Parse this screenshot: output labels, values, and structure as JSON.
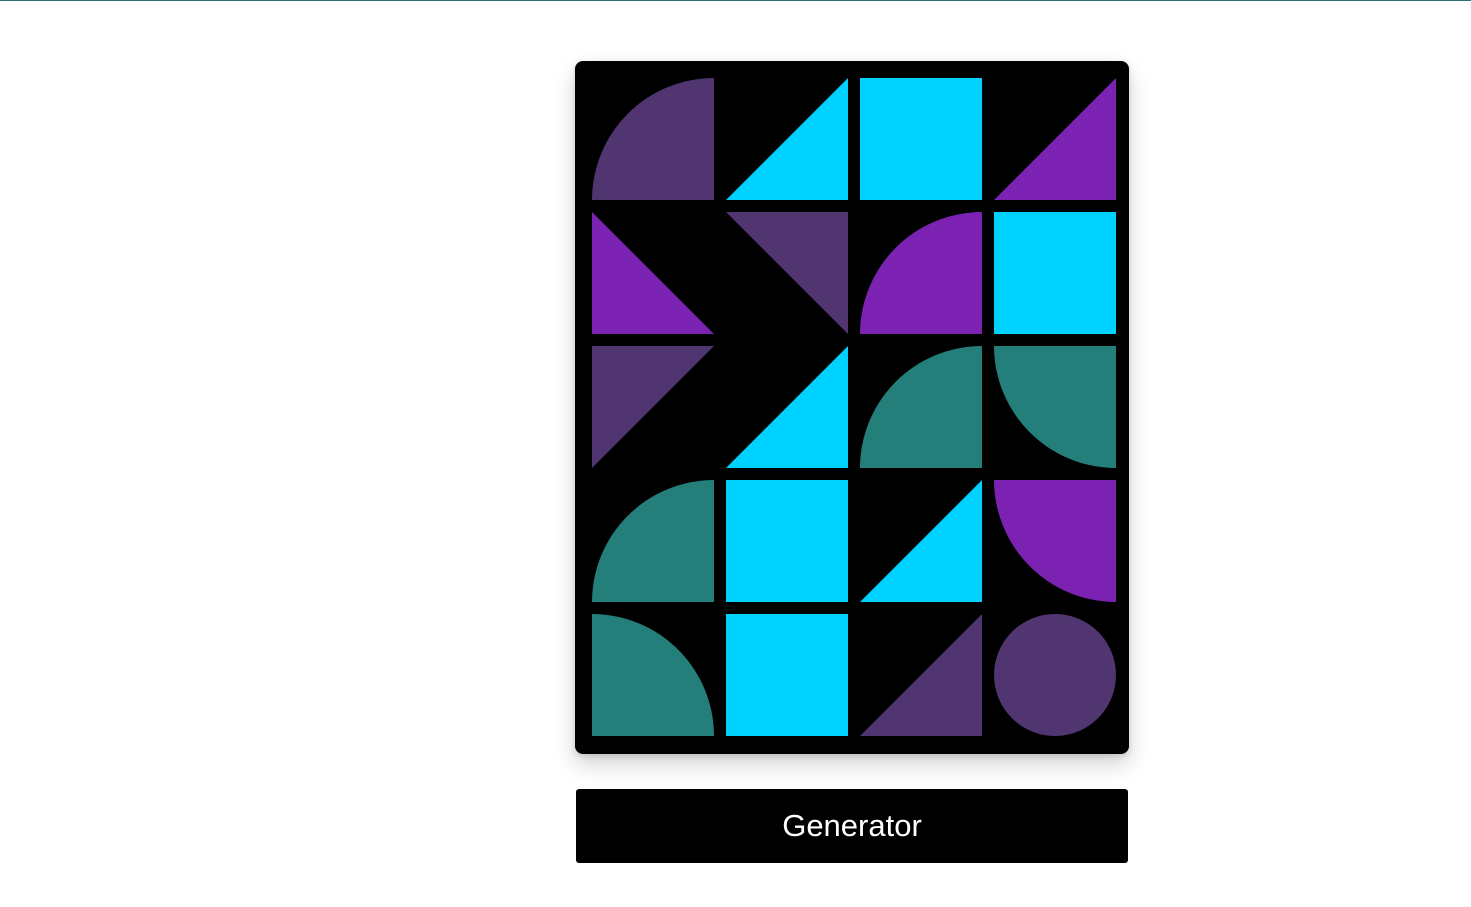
{
  "palette": {
    "black": "#000000",
    "cyan": "#00d2ff",
    "purple": "#7b22b3",
    "plum": "#513570",
    "teal": "#247f7b"
  },
  "grid": {
    "columns": 4,
    "rows": 5,
    "tiles": [
      {
        "shape": "quarter-circle-bottom-right",
        "color": "plum"
      },
      {
        "shape": "triangle-bottom-right",
        "color": "cyan"
      },
      {
        "shape": "square",
        "color": "cyan"
      },
      {
        "shape": "triangle-bottom-right",
        "color": "purple"
      },
      {
        "shape": "triangle-bottom-left",
        "color": "purple"
      },
      {
        "shape": "triangle-top-right",
        "color": "plum"
      },
      {
        "shape": "quarter-circle-bottom-right",
        "color": "purple"
      },
      {
        "shape": "square",
        "color": "cyan"
      },
      {
        "shape": "triangle-top-left",
        "color": "plum"
      },
      {
        "shape": "triangle-bottom-right",
        "color": "cyan"
      },
      {
        "shape": "quarter-circle-bottom-right",
        "color": "teal"
      },
      {
        "shape": "quarter-circle-top-right",
        "color": "teal"
      },
      {
        "shape": "quarter-circle-bottom-right",
        "color": "teal"
      },
      {
        "shape": "square",
        "color": "cyan"
      },
      {
        "shape": "triangle-bottom-right",
        "color": "cyan"
      },
      {
        "shape": "quarter-circle-top-right",
        "color": "purple"
      },
      {
        "shape": "quarter-circle-bottom-left",
        "color": "teal"
      },
      {
        "shape": "square",
        "color": "cyan"
      },
      {
        "shape": "triangle-bottom-right",
        "color": "plum"
      },
      {
        "shape": "circle",
        "color": "plum"
      }
    ]
  },
  "button": {
    "label": "Generator"
  }
}
